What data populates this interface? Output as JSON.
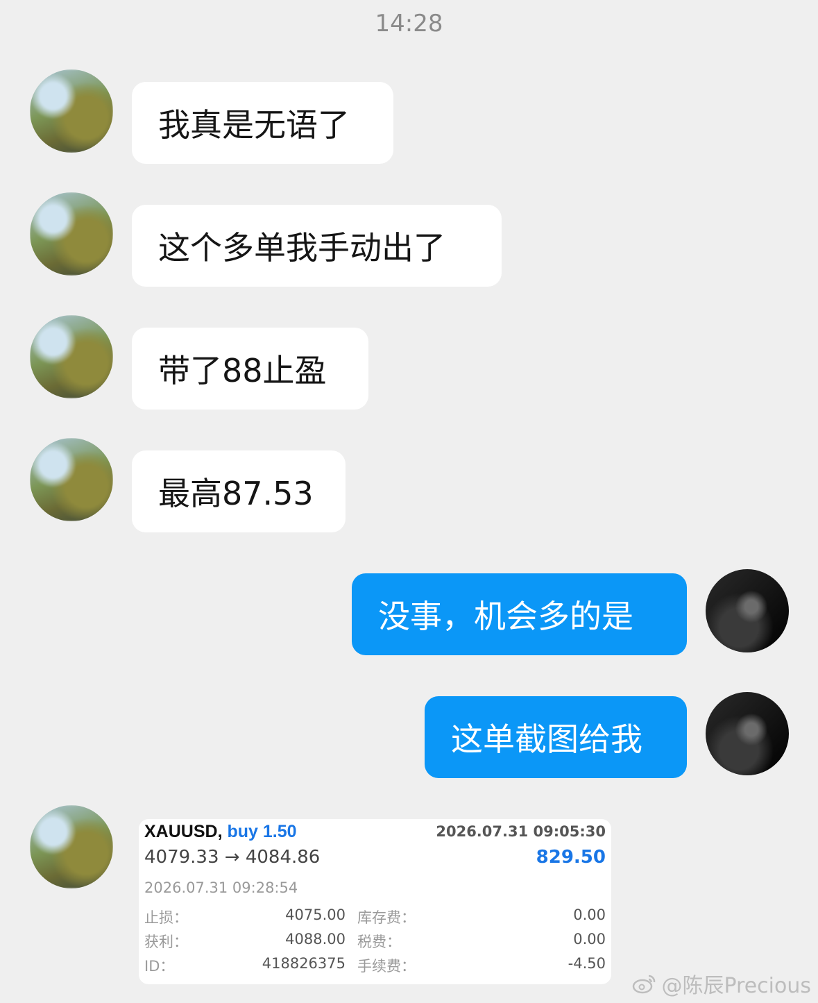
{
  "status": {
    "time": "14:28"
  },
  "messages": [
    {
      "sender": "other",
      "text": "我真是无语了"
    },
    {
      "sender": "other",
      "text": "这个多单我手动出了"
    },
    {
      "sender": "other",
      "text": "带了88止盈"
    },
    {
      "sender": "other",
      "text": "最高87.53"
    },
    {
      "sender": "me",
      "text": "没事，机会多的是"
    },
    {
      "sender": "me",
      "text": "这单截图给我"
    }
  ],
  "trade_card": {
    "symbol": "XAUUSD,",
    "side": "buy 1.50",
    "open_datetime": "2026.07.31 09:05:30",
    "prices": "4079.33 → 4084.86",
    "profit": "829.50",
    "close_datetime": "2026.07.31 09:28:54",
    "details": {
      "stop_loss_label": "止损：",
      "stop_loss_value": "4075.00",
      "take_profit_label": "获利：",
      "take_profit_value": "4088.00",
      "id_label": "ID：",
      "id_value": "418826375",
      "swap_label": "库存费：",
      "swap_value": "0.00",
      "tax_label": "税费：",
      "tax_value": "0.00",
      "commission_label": "手续费：",
      "commission_value": "-4.50"
    }
  },
  "watermark": {
    "text": "@陈辰Precious",
    "icon": "weibo-icon"
  },
  "colors": {
    "outgoing_bubble": "#0b97f7",
    "accent_blue": "#1976e6",
    "background": "#efefef"
  }
}
